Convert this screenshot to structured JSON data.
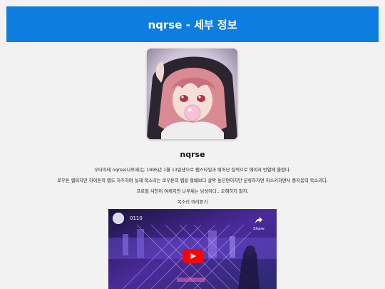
{
  "header": {
    "title": "nqrse - 세부 정보"
  },
  "profile": {
    "name": "nqrse",
    "bio_line1": "우타이테 nqrse(나루세)는 1995년 1월 13일생으로 랩스타일과 뛰어난 실력으로 에이저 반열에 올랐다.",
    "bio_line2": "로우톤 랩퍼지만 하이톤의 랩도 자주하며 실제 목소리는 로우톤의 랩을 할때보다 살짝 높은편이지만 분류하자면 허스키하면서 중저음의 목소리다.",
    "bio_line3": "프로필 사진이 여캐지만 나루세는 남성이다.. 오해하지 말자.",
    "voice_preview_label": "목소리 미리듣기"
  },
  "video": {
    "title": "0110",
    "share_label": "Share"
  },
  "colors": {
    "header_bg": "#0d7de0",
    "page_bg": "#f2f2f2",
    "play_button": "#ff0000"
  }
}
